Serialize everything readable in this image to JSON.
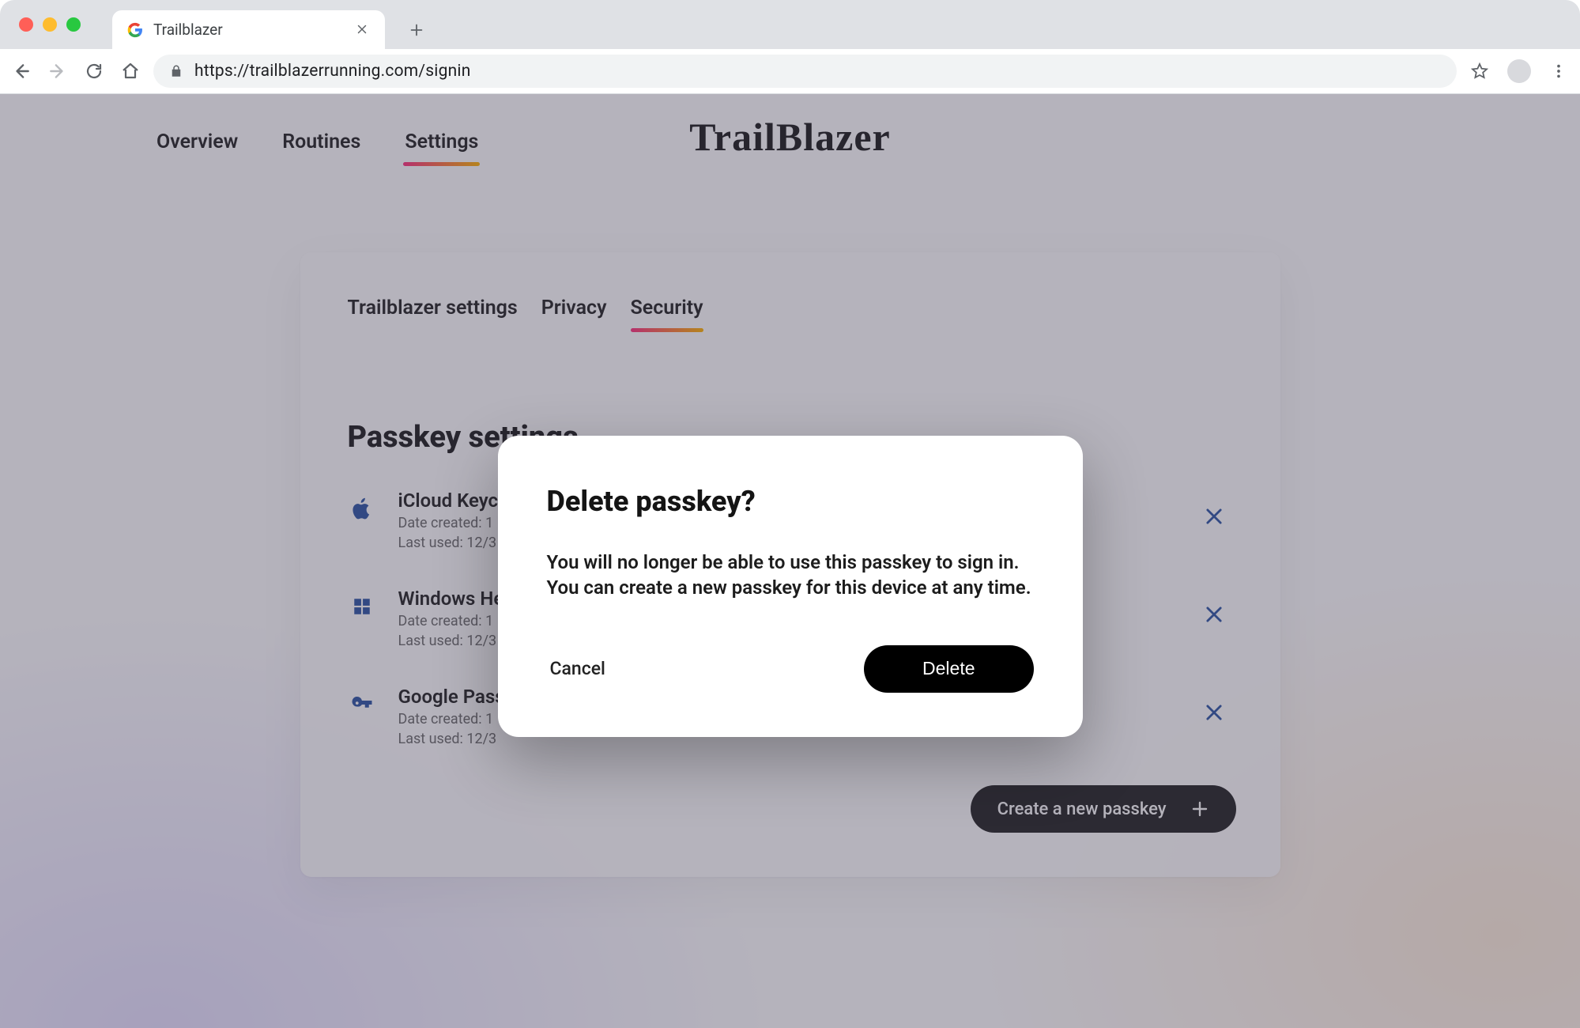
{
  "browser": {
    "tab_title": "Trailblazer",
    "url": "https://trailblazerrunning.com/signin"
  },
  "nav": {
    "items": [
      "Overview",
      "Routines",
      "Settings"
    ],
    "active_index": 2,
    "brand": "TrailBlazer"
  },
  "settings": {
    "subtabs": [
      "Trailblazer settings",
      "Privacy",
      "Security"
    ],
    "active_index": 2,
    "section_title": "Passkey settings",
    "passkeys": [
      {
        "name": "iCloud Keychain",
        "created_label": "Date created: 1",
        "last_used_label": "Last used: 12/3"
      },
      {
        "name": "Windows Hello",
        "created_label": "Date created: 1",
        "last_used_label": "Last used: 12/3"
      },
      {
        "name": "Google Password Manager",
        "created_label": "Date created: 1",
        "last_used_label": "Last used: 12/3"
      }
    ],
    "create_label": "Create a new passkey"
  },
  "dialog": {
    "title": "Delete passkey?",
    "body": "You will no longer be able to use this passkey to sign in. You can create a new passkey for this device at any time.",
    "cancel_label": "Cancel",
    "confirm_label": "Delete"
  }
}
